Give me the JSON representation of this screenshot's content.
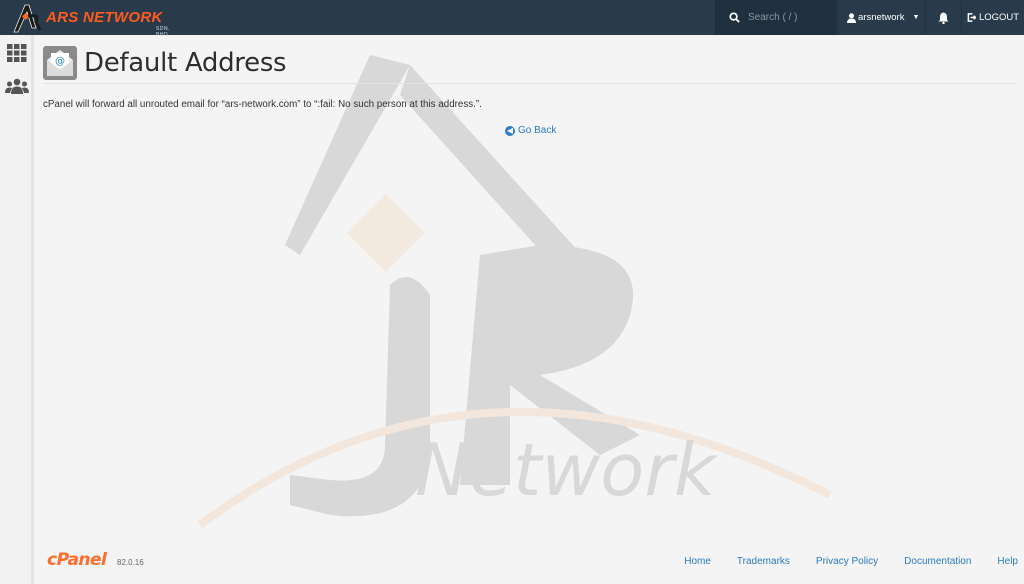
{
  "brand": {
    "name": "ARS NETWORK",
    "subtitle": "SDN. BHD."
  },
  "search": {
    "placeholder": "Search ( / )",
    "icon": "search-icon"
  },
  "user": {
    "name": "arsnetwork"
  },
  "logout_label": "LOGOUT",
  "sidebar": {
    "items": [
      {
        "icon": "grid-icon"
      },
      {
        "icon": "users-icon"
      }
    ]
  },
  "page": {
    "title": "Default Address",
    "message": "cPanel will forward all unrouted email for “ars-network.com” to “:fail: No such person at this address.”.",
    "go_back": "Go Back"
  },
  "watermark": {
    "text": "Network"
  },
  "footer": {
    "logo": "cPanel",
    "version": "82.0.16",
    "links": [
      "Home",
      "Trademarks",
      "Privacy Policy",
      "Documentation",
      "Help"
    ]
  },
  "colors": {
    "topbar": "#293a4a",
    "accent": "#ff5a1f",
    "link": "#2b7bc0"
  }
}
